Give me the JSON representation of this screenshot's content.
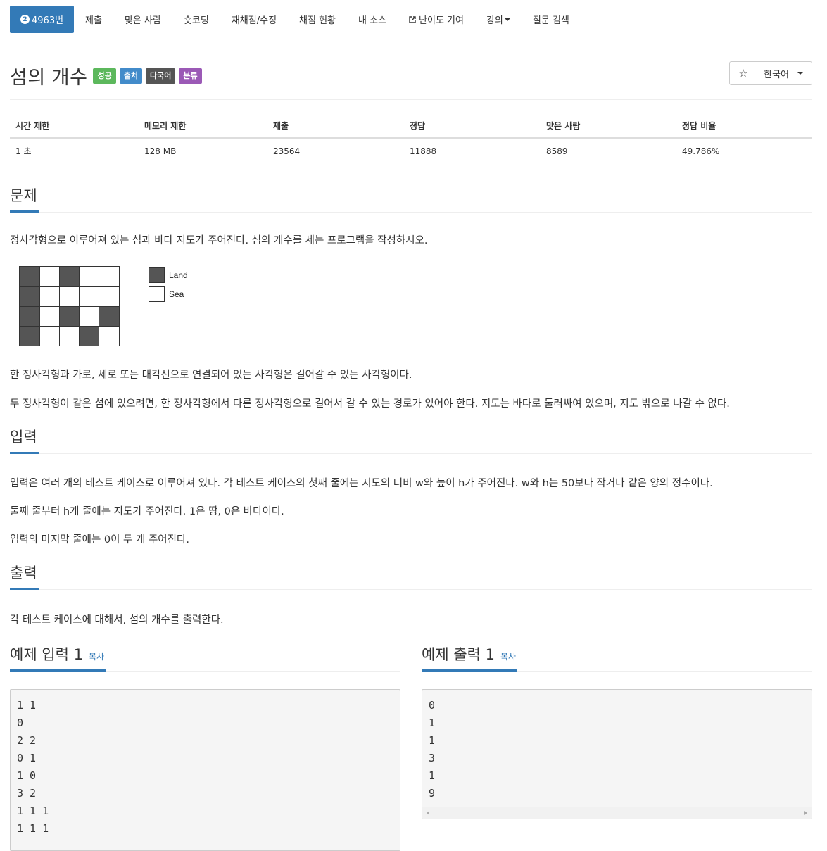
{
  "nav": {
    "problem_label": "4963번",
    "tier_mark": "2",
    "items": [
      "제출",
      "맞은 사람",
      "숏코딩",
      "재채점/수정",
      "채점 현황",
      "내 소스",
      "난이도 기여",
      "강의",
      "질문 검색"
    ]
  },
  "title": {
    "text": "섬의 개수",
    "labels": [
      "성공",
      "출처",
      "다국어",
      "분류"
    ],
    "label_colors": [
      "#5cb85c",
      "#428bca",
      "#555555",
      "#9b59b6"
    ]
  },
  "toolbar": {
    "star_icon": "star-icon",
    "language": "한국어"
  },
  "info": {
    "headers": [
      "시간 제한",
      "메모리 제한",
      "제출",
      "정답",
      "맞은 사람",
      "정답 비율"
    ],
    "values": [
      "1 초",
      "128 MB",
      "23564",
      "11888",
      "8589",
      "49.786%"
    ]
  },
  "problem": {
    "heading": "문제",
    "p1": "정사각형으로 이루어져 있는 섬과 바다 지도가 주어진다. 섬의 개수를 세는 프로그램을 작성하시오.",
    "figure": {
      "grid": [
        [
          1,
          0,
          1,
          0,
          0
        ],
        [
          1,
          0,
          0,
          0,
          0
        ],
        [
          1,
          0,
          1,
          0,
          1
        ],
        [
          1,
          0,
          0,
          1,
          0
        ]
      ],
      "legend_land": "Land",
      "legend_sea": "Sea"
    },
    "p2": "한 정사각형과 가로, 세로 또는 대각선으로 연결되어 있는 사각형은 걸어갈 수 있는 사각형이다.",
    "p3": "두 정사각형이 같은 섬에 있으려면, 한 정사각형에서 다른 정사각형으로 걸어서 갈 수 있는 경로가 있어야 한다. 지도는 바다로 둘러싸여 있으며, 지도 밖으로 나갈 수 없다."
  },
  "input": {
    "heading": "입력",
    "p1": "입력은 여러 개의 테스트 케이스로 이루어져 있다. 각 테스트 케이스의 첫째 줄에는 지도의 너비 w와 높이 h가 주어진다. w와 h는 50보다 작거나 같은 양의 정수이다.",
    "p2": "둘째 줄부터 h개 줄에는 지도가 주어진다. 1은 땅, 0은 바다이다.",
    "p3": "입력의 마지막 줄에는 0이 두 개 주어진다."
  },
  "output": {
    "heading": "출력",
    "p1": "각 테스트 케이스에 대해서, 섬의 개수를 출력한다."
  },
  "sample_input": {
    "heading": "예제 입력 1",
    "copy": "복사",
    "lines": [
      "1 1",
      "0",
      "2 2",
      "0 1",
      "1 0",
      "3 2",
      "1 1 1",
      "1 1 1"
    ]
  },
  "sample_output": {
    "heading": "예제 출력 1",
    "copy": "복사",
    "lines": [
      "0",
      "1",
      "1",
      "3",
      "1",
      "9"
    ]
  },
  "colors": {
    "accent": "#337ab7"
  }
}
